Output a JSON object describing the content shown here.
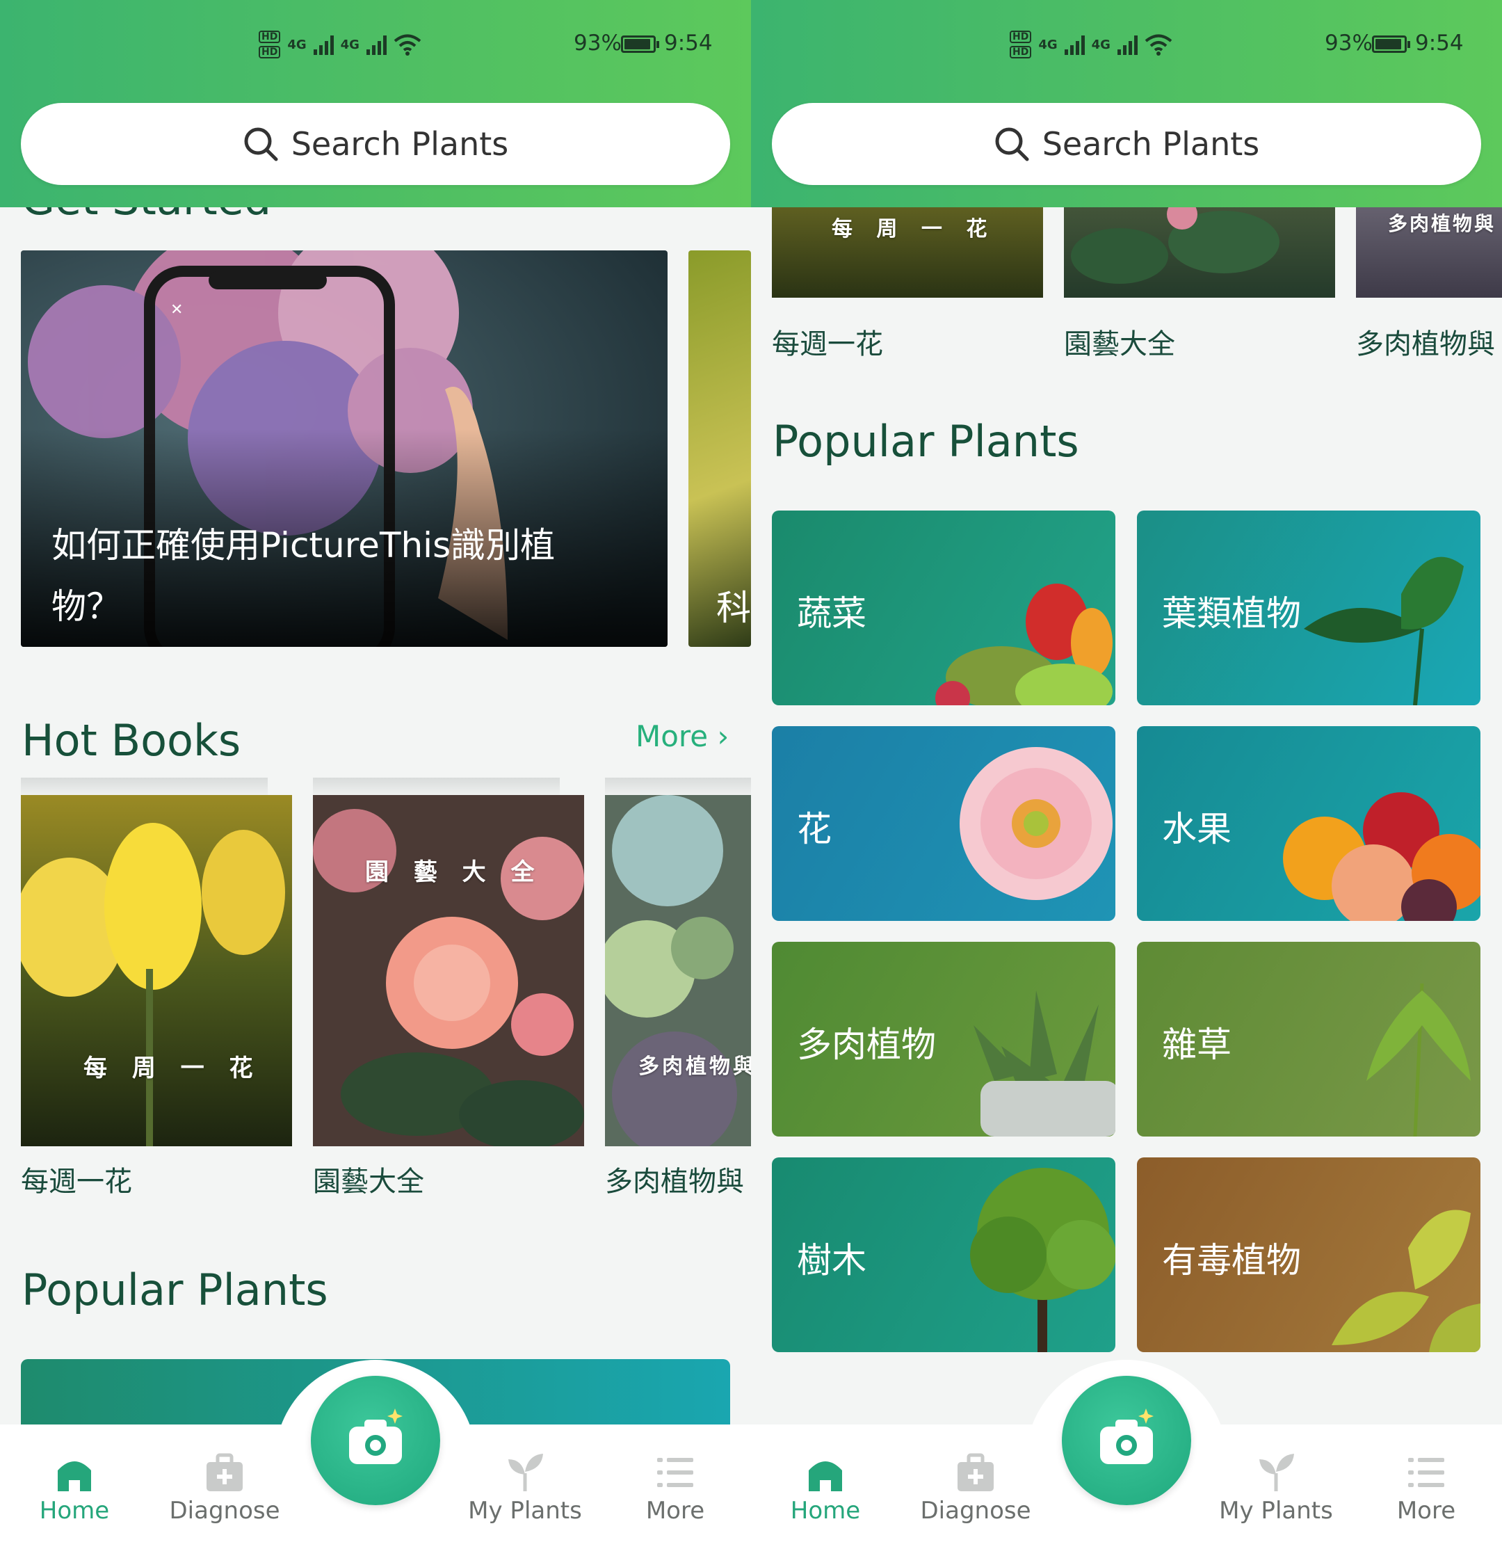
{
  "status": {
    "battery": "93%",
    "time": "9:54",
    "hd": "HD",
    "net": "4G",
    "battery_level": 0.93
  },
  "search": {
    "placeholder": "Search Plants"
  },
  "left": {
    "get_started_title": "Get Started",
    "cards": [
      {
        "text": "如何正確使用PictureThis識別植物？"
      },
      {
        "text": "科"
      }
    ],
    "hot_books_title": "Hot Books",
    "more": "More",
    "books": [
      {
        "overlay": "每 周 一 花",
        "title": "每週一花"
      },
      {
        "overlay": "園 藝 大 全",
        "title": "園藝大全"
      },
      {
        "overlay": "多肉植物與",
        "title": "多肉植物與"
      }
    ],
    "popular_title": "Popular Plants"
  },
  "right": {
    "books": [
      {
        "overlay": "每 周 一 花",
        "title": "每週一花"
      },
      {
        "title": "園藝大全"
      },
      {
        "overlay": "多肉植物與",
        "title": "多肉植物與"
      }
    ],
    "popular_title": "Popular Plants",
    "categories": [
      {
        "label": "蔬菜",
        "color": "#1f9274"
      },
      {
        "label": "葉類植物",
        "color": "#1b9aa0"
      },
      {
        "label": "花",
        "color": "#1f86a8"
      },
      {
        "label": "水果",
        "color": "#179a9c"
      },
      {
        "label": "多肉植物",
        "color": "#5e8b35"
      },
      {
        "label": "雜草",
        "color": "#6b8c3e"
      },
      {
        "label": "樹木",
        "color": "#1a8f76"
      },
      {
        "label": "有毒植物",
        "color": "#9a6a2e"
      }
    ]
  },
  "nav": {
    "items": [
      {
        "label": "Home",
        "icon": "home-icon",
        "active": true
      },
      {
        "label": "Diagnose",
        "icon": "diagnose-icon"
      },
      {
        "label": "My Plants",
        "icon": "sprout-icon"
      },
      {
        "label": "More",
        "icon": "menu-list-icon"
      }
    ],
    "camera_icon": "camera-icon"
  },
  "colors": {
    "header_green": "#4fbf63",
    "accent": "#25a67b",
    "title_dark_green": "#17503a"
  }
}
